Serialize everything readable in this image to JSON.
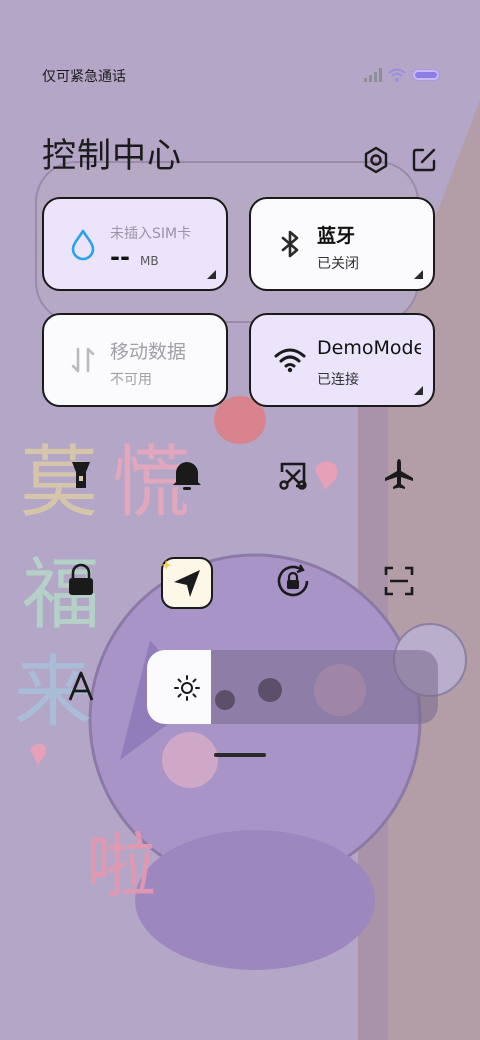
{
  "status_bar": {
    "carrier": "仅可紧急通话"
  },
  "title": "控制中心",
  "header_buttons": {
    "settings_icon": "gear-icon",
    "edit_icon": "edit-icon"
  },
  "tiles": {
    "data_usage": {
      "label": "未插入SIM卡",
      "value": "--",
      "unit": "MB",
      "icon": "water-drop-icon"
    },
    "bluetooth": {
      "title": "蓝牙",
      "status": "已关闭",
      "icon": "bluetooth-icon"
    },
    "mobile_data": {
      "title": "移动数据",
      "status": "不可用",
      "icon": "mobile-data-icon"
    },
    "wifi": {
      "title": "DemoMode",
      "status": "已连接",
      "icon": "wifi-icon"
    }
  },
  "quick_toggles": [
    {
      "name": "flashlight-icon"
    },
    {
      "name": "bell-icon"
    },
    {
      "name": "screenshot-icon"
    },
    {
      "name": "airplane-icon"
    },
    {
      "name": "lock-icon"
    },
    {
      "name": "location-icon"
    },
    {
      "name": "rotation-lock-icon"
    },
    {
      "name": "scan-icon"
    },
    {
      "name": "font-icon"
    }
  ],
  "brightness": {
    "level": 0.22,
    "icon": "sun-icon"
  },
  "wallpaper_text": [
    "莫",
    "慌",
    "福",
    "来",
    "啦"
  ],
  "colors": {
    "active_tile": "#ece4fb",
    "inactive_tile": "#fbfbfd",
    "background": "#b3a6c7",
    "accent_blue": "#2aa3ea"
  }
}
